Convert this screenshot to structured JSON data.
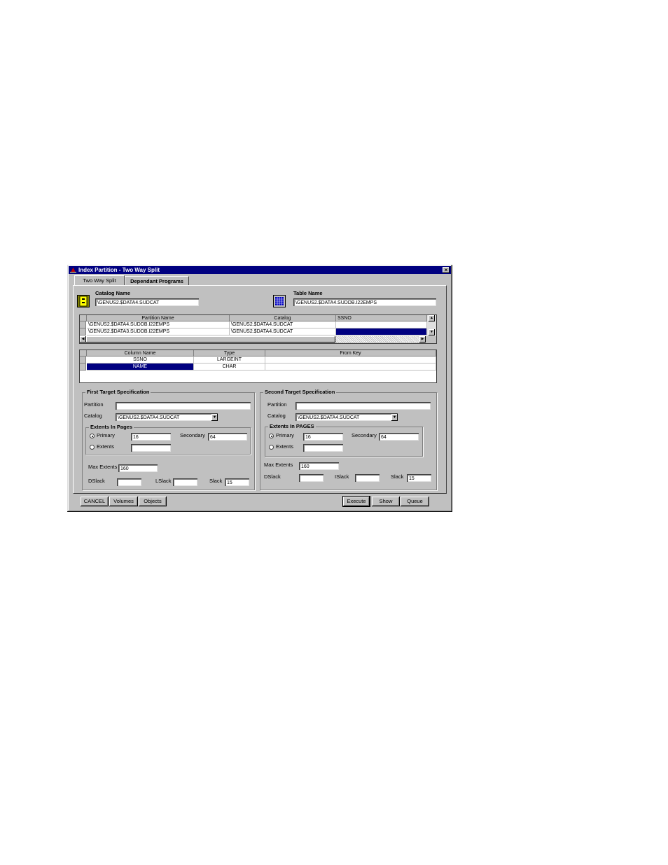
{
  "window": {
    "title": "Index Partition - Two Way Split",
    "close_glyph": "×"
  },
  "tabs": [
    {
      "label": "Two Way Split",
      "active": true
    },
    {
      "label": "Dependant Programs",
      "active": false
    }
  ],
  "catalog": {
    "label": "Catalog Name",
    "value": "\\GENUS2.$DATA4.SUDCAT",
    "icon": "catalog-icon"
  },
  "table": {
    "label": "Table Name",
    "value": "\\GENUS2.$DATA4.SUDDB.I22EMPS",
    "icon": "table-icon"
  },
  "partition_grid": {
    "columns": [
      "Partition Name",
      "Catalog",
      "SSNO"
    ],
    "rows": [
      [
        "\\GENUS2.$DATA4.SUDDB.I22EMPS",
        "\\GENUS2.$DATA4.SUDCAT",
        ""
      ],
      [
        "\\GENUS2.$DATA3.SUDDB.I22EMPS",
        "\\GENUS2.$DATA4.SUDCAT",
        ""
      ]
    ]
  },
  "column_grid": {
    "columns": [
      "Column Name",
      "Type",
      "From Key"
    ],
    "rows": [
      [
        "SSNO",
        "LARGEINT",
        ""
      ],
      [
        "NAME",
        "CHAR",
        ""
      ]
    ],
    "selected_row": 1
  },
  "first_target": {
    "title": "First Target Specification",
    "partition_label": "Partition",
    "partition_value": "",
    "catalog_label": "Catalog",
    "catalog_value": "\\GENUS2.$DATA4.SUDCAT",
    "extents_title": "Extents In Pages",
    "primary_label": "Primary",
    "primary_value": "16",
    "secondary_label": "Secondary",
    "secondary_value": "64",
    "extents_label": "Extents",
    "extents_value": "",
    "max_extents_label": "Max Extents",
    "max_extents_value": "160",
    "dslack_label": "DSlack",
    "dslack_value": "",
    "islack_label": "LSlack",
    "islack_value": "",
    "slack_label": "Slack",
    "slack_value": "15"
  },
  "second_target": {
    "title": "Second Target Specification",
    "partition_label": "Partition",
    "partition_value": "",
    "catalog_label": "Catalog",
    "catalog_value": "\\GENUS2.$DATA4.SUDCAT",
    "extents_title": "Extents In PAGES",
    "primary_label": "Primary",
    "primary_value": "16",
    "secondary_label": "Secondary",
    "secondary_value": "64",
    "extents_label": "Extents",
    "extents_value": "",
    "max_extents_label": "Max Extents",
    "max_extents_value": "160",
    "dslack_label": "DSlack",
    "dslack_value": "",
    "islack_label": "ISlack",
    "islack_value": "",
    "slack_label": "Slack",
    "slack_value": "15"
  },
  "buttons": {
    "cancel": "CANCEL",
    "volumes": "Volumes",
    "objects": "Objects",
    "execute": "Execute",
    "show": "Show",
    "queue": "Queue"
  },
  "colors": {
    "face": "#c0c0c0",
    "titlebar": "#000080",
    "selection": "#000080"
  }
}
